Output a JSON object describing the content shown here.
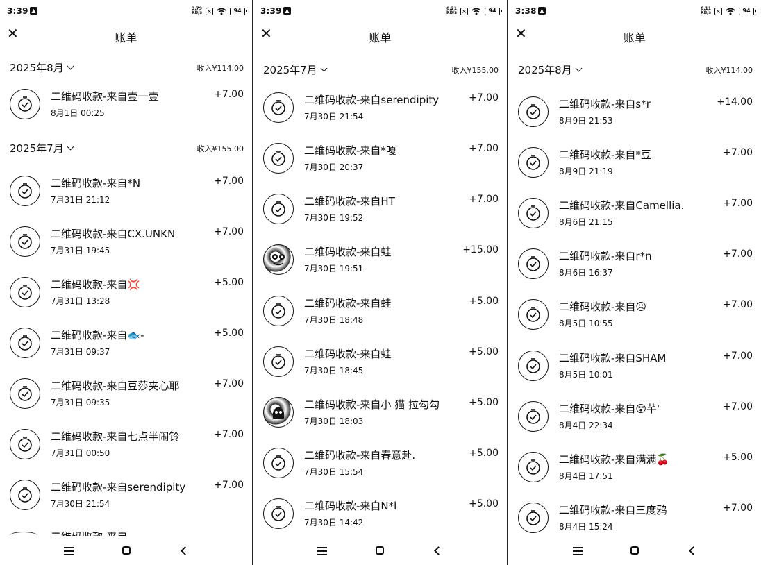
{
  "panels": [
    {
      "status": {
        "time": "3:39",
        "speed_top": "3.79",
        "speed_unit": "KB/s",
        "battery": "94"
      },
      "title": "账单",
      "groups": [
        {
          "month": "2025年8月",
          "income": "收入¥114.00"
        },
        {
          "month": "2025年7月",
          "income": "收入¥155.00"
        }
      ],
      "transactions": [
        {
          "name": "二维码收款-来自壹一壹",
          "date": "8月1日 00:25",
          "amount": "+7.00"
        },
        {
          "name": "二维码收款-来自*N",
          "date": "7月31日 21:12",
          "amount": "+7.00"
        },
        {
          "name": "二维码收款-来自CX.UNKN",
          "date": "7月31日 19:45",
          "amount": "+7.00"
        },
        {
          "name": "二维码收款-来自💢",
          "date": "7月31日 13:28",
          "amount": "+5.00"
        },
        {
          "name": "二维码收款-来自🐟-",
          "date": "7月31日 09:37",
          "amount": "+5.00"
        },
        {
          "name": "二维码收款-来自豆莎夹心耶",
          "date": "7月31日 09:35",
          "amount": "+7.00"
        },
        {
          "name": "二维码收款-来自七点半闹铃",
          "date": "7月31日 00:50",
          "amount": "+7.00"
        },
        {
          "name": "二维码收款-来自serendipity",
          "date": "7月30日 21:54",
          "amount": "+7.00"
        }
      ],
      "cut_text": "二维码收款-来自"
    },
    {
      "status": {
        "time": "3:39",
        "speed_top": "0.21",
        "speed_unit": "KB/s",
        "battery": "94"
      },
      "title": "账单",
      "groups": [
        {
          "month": "2025年7月",
          "income": "收入¥155.00"
        }
      ],
      "transactions": [
        {
          "name": "二维码收款-来自serendipity",
          "date": "7月30日 21:54",
          "amount": "+7.00"
        },
        {
          "name": "二维码收款-来自*嗄",
          "date": "7月30日 20:37",
          "amount": "+7.00"
        },
        {
          "name": "二维码收款-来自HT",
          "date": "7月30日 19:52",
          "amount": "+7.00"
        },
        {
          "name": "二维码收款-来自蛙",
          "date": "7月30日 19:51",
          "amount": "+15.00"
        },
        {
          "name": "二维码收款-来自蛙",
          "date": "7月30日 18:48",
          "amount": "+5.00"
        },
        {
          "name": "二维码收款-来自蛙",
          "date": "7月30日 18:45",
          "amount": "+5.00"
        },
        {
          "name": "二维码收款-来自小  猫  拉勾勾",
          "date": "7月30日 18:03",
          "amount": "+5.00"
        },
        {
          "name": "二维码收款-来自春意赴.",
          "date": "7月30日 15:54",
          "amount": "+5.00"
        },
        {
          "name": "二维码收款-来自N*l",
          "date": "7月30日 14:42",
          "amount": "+5.00"
        }
      ]
    },
    {
      "status": {
        "time": "3:38",
        "speed_top": "0.11",
        "speed_unit": "KB/s",
        "battery": "94"
      },
      "title": "账单",
      "groups": [
        {
          "month": "2025年8月",
          "income": "收入¥114.00"
        }
      ],
      "transactions": [
        {
          "name": "二维码收款-来自s*r",
          "date": "8月9日 21:53",
          "amount": "+14.00"
        },
        {
          "name": "二维码收款-来自*豆",
          "date": "8月9日 21:19",
          "amount": "+7.00"
        },
        {
          "name": "二维码收款-来自Camellia.",
          "date": "8月6日 21:15",
          "amount": "+7.00"
        },
        {
          "name": "二维码收款-来自r*n",
          "date": "8月6日 16:37",
          "amount": "+7.00"
        },
        {
          "name": "二维码收款-来自☹",
          "date": "8月5日 10:55",
          "amount": "+7.00"
        },
        {
          "name": "二维码收款-来自SHAM",
          "date": "8月5日 10:01",
          "amount": "+7.00"
        },
        {
          "name": "二维码收款-来自😵芊'",
          "date": "8月4日 22:34",
          "amount": "+7.00"
        },
        {
          "name": "二维码收款-来自满满🍒",
          "date": "8月4日 17:51",
          "amount": "+5.00"
        },
        {
          "name": "二维码收款-来自三度鸦",
          "date": "8月4日 15:24",
          "amount": "+7.00"
        }
      ]
    }
  ]
}
